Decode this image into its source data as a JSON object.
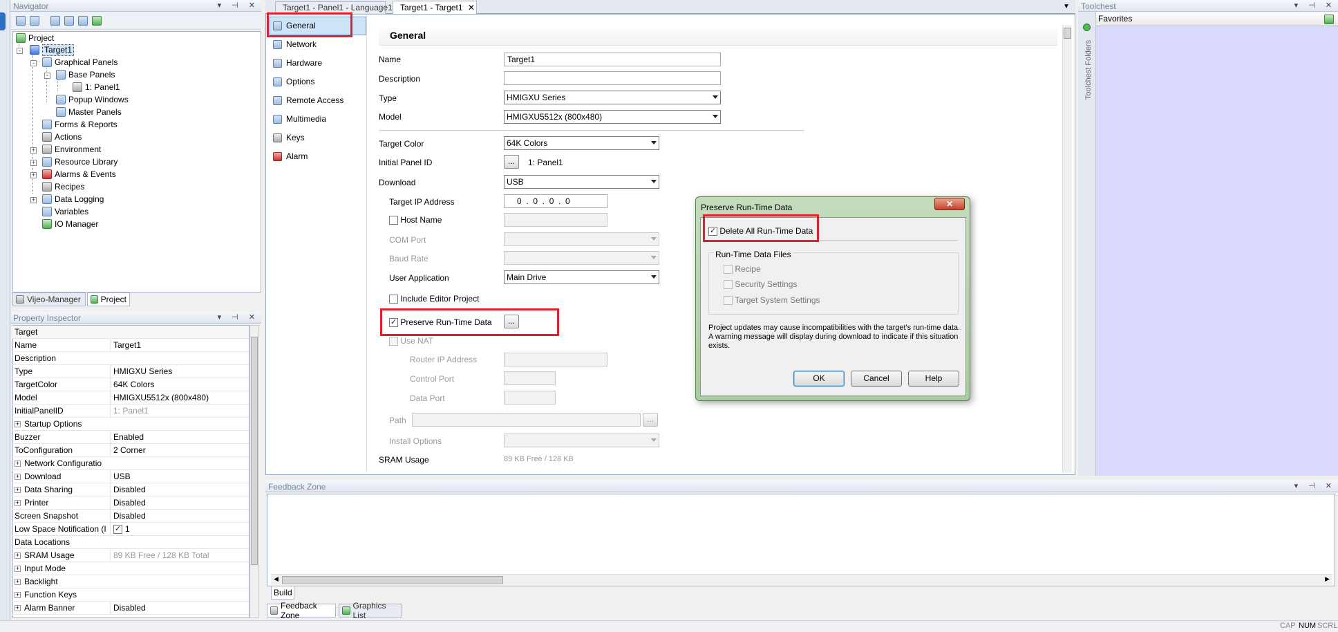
{
  "navigator": {
    "title": "Navigator",
    "tree": [
      {
        "label": "Project"
      },
      {
        "label": "Target1"
      },
      {
        "label": "Graphical Panels"
      },
      {
        "label": "Base Panels"
      },
      {
        "label": "1: Panel1"
      },
      {
        "label": "Popup Windows"
      },
      {
        "label": "Master Panels"
      },
      {
        "label": "Forms & Reports"
      },
      {
        "label": "Actions"
      },
      {
        "label": "Environment"
      },
      {
        "label": "Resource Library"
      },
      {
        "label": "Alarms & Events"
      },
      {
        "label": "Recipes"
      },
      {
        "label": "Data Logging"
      },
      {
        "label": "Variables"
      },
      {
        "label": "IO Manager"
      }
    ],
    "tabs": [
      "Vijeo-Manager",
      "Project"
    ]
  },
  "property_inspector": {
    "title": "Property Inspector",
    "header": "Target",
    "rows": [
      {
        "key": "Name",
        "value": "Target1"
      },
      {
        "key": "Description",
        "value": ""
      },
      {
        "key": "Type",
        "value": "HMIGXU Series"
      },
      {
        "key": "TargetColor",
        "value": "64K Colors"
      },
      {
        "key": "Model",
        "value": "HMIGXU5512x (800x480)"
      },
      {
        "key": "InitialPanelID",
        "value": "1: Panel1"
      },
      {
        "key": "Startup Options",
        "value": ""
      },
      {
        "key": "Buzzer",
        "value": "Enabled"
      },
      {
        "key": "ToConfiguration",
        "value": "2 Corner"
      },
      {
        "key": "Network Configuratio",
        "value": ""
      },
      {
        "key": "Download",
        "value": "USB"
      },
      {
        "key": "Data Sharing",
        "value": "Disabled"
      },
      {
        "key": "Printer",
        "value": "Disabled"
      },
      {
        "key": "Screen Snapshot",
        "value": "Disabled"
      },
      {
        "key": "Low Space Notification (I",
        "value": "1"
      },
      {
        "key": "Data Locations",
        "value": ""
      },
      {
        "key": "SRAM Usage",
        "value": "89 KB Free / 128 KB Total"
      },
      {
        "key": "Input Mode",
        "value": ""
      },
      {
        "key": "Backlight",
        "value": ""
      },
      {
        "key": "Function Keys",
        "value": ""
      },
      {
        "key": "Alarm Banner",
        "value": "Disabled"
      }
    ]
  },
  "editor": {
    "tabs": [
      "Target1 - Panel1 - Language1",
      "Target1 - Target1"
    ],
    "close_glyph": "✕",
    "nav": [
      "General",
      "Network",
      "Hardware",
      "Options",
      "Remote Access",
      "Multimedia",
      "Keys",
      "Alarm"
    ],
    "section_title": "General",
    "form": {
      "name_label": "Name",
      "name_value": "Target1",
      "description_label": "Description",
      "description_value": "",
      "type_label": "Type",
      "type_value": "HMIGXU Series",
      "model_label": "Model",
      "model_value": "HMIGXU5512x (800x480)",
      "target_color_label": "Target Color",
      "target_color_value": "64K Colors",
      "initial_panel_label": "Initial Panel ID",
      "initial_panel_btn": "...",
      "initial_panel_value": "1: Panel1",
      "download_label": "Download",
      "download_value": "USB",
      "target_ip_label": "Target IP Address",
      "target_ip_value": "0  .  0  .  0  .  0",
      "host_name_label": "Host Name",
      "com_port_label": "COM Port",
      "baud_rate_label": "Baud Rate",
      "user_app_label": "User Application",
      "user_app_value": "Main Drive",
      "include_editor_label": "Include Editor Project",
      "preserve_label": "Preserve Run-Time Data",
      "preserve_btn": "...",
      "use_nat_label": "Use NAT",
      "router_ip_label": "Router IP Address",
      "control_port_label": "Control Port",
      "data_port_label": "Data Port",
      "path_label": "Path",
      "path_btn": "...",
      "install_options_label": "Install Options",
      "sram_label": "SRAM Usage",
      "sram_value": "89 KB Free / 128 KB"
    }
  },
  "dialog": {
    "title": "Preserve Run-Time Data",
    "delete_all_label": "Delete All Run-Time Data",
    "group_title": "Run-Time Data Files",
    "files": [
      "Recipe",
      "Security Settings",
      "Target System Settings"
    ],
    "message": "Project updates may cause incompatibilities with the target's run-time data.  A warning message will display during download to indicate if this situation exists.",
    "ok": "OK",
    "cancel": "Cancel",
    "help": "Help"
  },
  "toolchest": {
    "title": "Toolchest",
    "favorites": "Favorites",
    "folders_label": "Toolchest Folders"
  },
  "feedback": {
    "title": "Feedback Zone",
    "build_tab": "Build",
    "bottom_tabs": [
      "Feedback Zone",
      "Graphics List"
    ]
  },
  "statusbar": {
    "indicators": [
      "CAP",
      "NUM",
      "SCRL"
    ]
  },
  "colors": {
    "highlight": "#e0202c",
    "toolchest_bg": "#d9d9fb",
    "selected": "#cde4f9"
  }
}
